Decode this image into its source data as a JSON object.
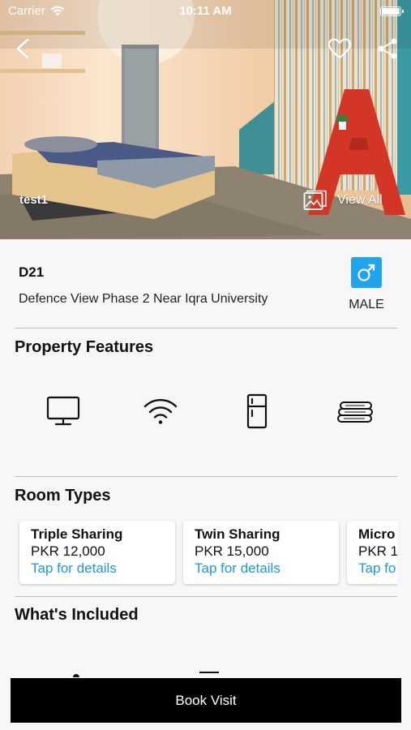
{
  "status_bar": {
    "carrier": "Carrier",
    "time": "10:11 AM"
  },
  "hero": {
    "caption": "test1",
    "view_all_label": "View All"
  },
  "property": {
    "name": "D21",
    "address": "Defence View Phase 2 Near Iqra University",
    "gender": "MALE",
    "gender_icon": "male-symbol-icon",
    "accent_color": "#21a4ee"
  },
  "features": {
    "title": "Property Features",
    "items": [
      "tv-icon",
      "wifi-icon",
      "fridge-icon",
      "bedding-icon"
    ]
  },
  "room_types": {
    "title": "Room Types",
    "items": [
      {
        "title": "Triple Sharing",
        "price": "PKR 12,000",
        "link": "Tap for details"
      },
      {
        "title": "Twin Sharing",
        "price": "PKR 15,000",
        "link": "Tap for details"
      },
      {
        "title": "Micro",
        "price": "PKR 1",
        "link": "Tap fo"
      }
    ]
  },
  "included": {
    "title": "What's Included"
  },
  "book_button": {
    "label": "Book Visit"
  }
}
